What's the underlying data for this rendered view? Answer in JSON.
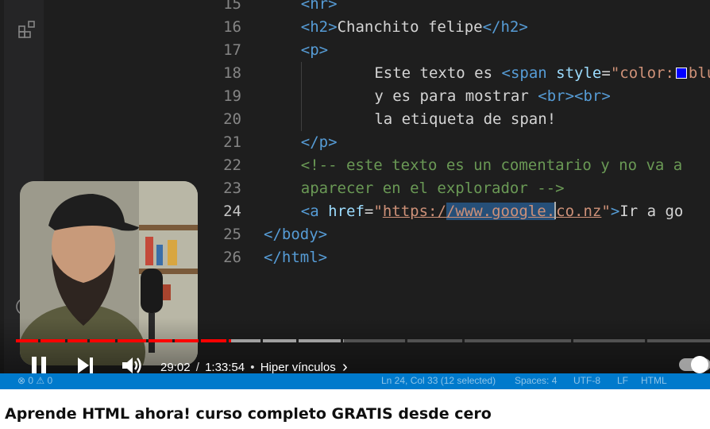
{
  "editor": {
    "lines": [
      {
        "num": "15",
        "code": [
          [
            "tag",
            "<hr>"
          ]
        ]
      },
      {
        "num": "16",
        "code": [
          [
            "tag",
            "<h2>"
          ],
          [
            "text",
            "Chanchito felipe"
          ],
          [
            "tag",
            "</h2>"
          ]
        ]
      },
      {
        "num": "17",
        "code": [
          [
            "tag",
            "<p>"
          ]
        ]
      },
      {
        "num": "18",
        "code": [
          [
            "text",
            "    Este texto es "
          ],
          [
            "tag",
            "<span"
          ],
          [
            "text",
            " "
          ],
          [
            "attr",
            "style"
          ],
          [
            "text",
            "="
          ],
          [
            "str",
            "\"color:"
          ],
          [
            "swatch",
            ""
          ],
          [
            "str",
            "blu"
          ]
        ]
      },
      {
        "num": "19",
        "code": [
          [
            "text",
            "    y es para mostrar "
          ],
          [
            "tag",
            "<br><br>"
          ]
        ]
      },
      {
        "num": "20",
        "code": [
          [
            "text",
            "    la etiqueta de span!"
          ]
        ]
      },
      {
        "num": "21",
        "code": [
          [
            "tag",
            "</p>"
          ]
        ]
      },
      {
        "num": "22",
        "code": [
          [
            "comment",
            "<!-- este texto es un comentario y no va a"
          ]
        ]
      },
      {
        "num": "23",
        "code": [
          [
            "comment",
            "aparecer en el explorador -->"
          ]
        ]
      },
      {
        "num": "24",
        "code": [
          [
            "tag",
            "<a"
          ],
          [
            "text",
            " "
          ],
          [
            "attr",
            "href"
          ],
          [
            "text",
            "="
          ],
          [
            "str",
            "\""
          ],
          [
            "link",
            "https:/"
          ],
          [
            "sel",
            "/www.google."
          ],
          [
            "cursor",
            ""
          ],
          [
            "link",
            "co.nz"
          ],
          [
            "str",
            "\""
          ],
          [
            "tag",
            ">"
          ],
          [
            "text",
            "Ir a go"
          ]
        ]
      },
      {
        "num": "25",
        "code": [
          [
            "tag",
            "</body>"
          ]
        ]
      },
      {
        "num": "26",
        "code": [
          [
            "tag",
            "</html>"
          ]
        ]
      }
    ],
    "line_indents": [
      1,
      1,
      1,
      2,
      2,
      2,
      1,
      1,
      1,
      1,
      0,
      0
    ],
    "active_line": "24"
  },
  "player": {
    "current_time": "29:02",
    "duration": "1:33:54",
    "time_separator": "/",
    "chapter_bullet": "•",
    "chapter": "Hiper vínculos",
    "chapter_chevron": "›",
    "progress_fraction": 0.309,
    "buffer_fraction": 0.472,
    "chapter_marks": [
      0.032,
      0.071,
      0.103,
      0.143,
      0.187,
      0.225,
      0.263,
      0.303,
      0.352,
      0.403,
      0.467,
      0.559,
      0.641,
      0.798,
      0.904
    ],
    "autoplay_on": true
  },
  "status_bar": {
    "problems": "⊗ 0 ⚠ 0",
    "cursor_pos": "Ln 24, Col 33 (12 selected)",
    "spaces": "Spaces: 4",
    "encoding": "UTF-8",
    "eol": "LF",
    "language": "HTML"
  },
  "video": {
    "title": "Aprende HTML ahora! curso completo GRATIS desde cero"
  },
  "colors": {
    "progress_played": "#ff0000",
    "editor_bg": "#1e1e1e",
    "status_bar": "#007acc"
  }
}
